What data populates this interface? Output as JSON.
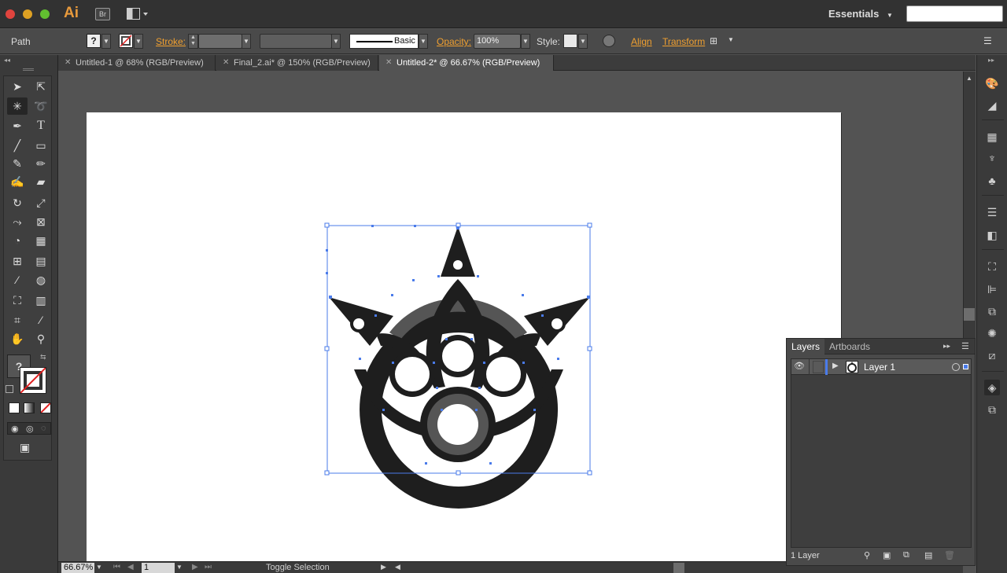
{
  "app": {
    "logo": "Ai",
    "bridge": "Br",
    "workspace": "Essentials",
    "search_placeholder": ""
  },
  "control_bar": {
    "selection_type": "Path",
    "stroke_label": "Stroke:",
    "brush_label": "Basic",
    "opacity_label": "Opacity:",
    "opacity_value": "100%",
    "style_label": "Style:",
    "align_label": "Align",
    "transform_label": "Transform",
    "fill_label": "?"
  },
  "tabs": [
    {
      "label": "Untitled-1 @ 68% (RGB/Preview)",
      "active": false
    },
    {
      "label": "Final_2.ai* @ 150% (RGB/Preview)",
      "active": false
    },
    {
      "label": "Untitled-2* @ 66.67% (RGB/Preview)",
      "active": true
    }
  ],
  "toolbox": {
    "fill_label": "?"
  },
  "status_bar": {
    "zoom": "66.67%",
    "page": "1",
    "status_text": "Toggle Selection"
  },
  "layers_panel": {
    "tabs": [
      "Layers",
      "Artboards"
    ],
    "layers": [
      {
        "name": "Layer 1"
      }
    ],
    "count_label": "1 Layer"
  },
  "colors": {
    "accent_orange": "#f0a030",
    "selection_blue": "#4a7bea",
    "artwork_dark": "#1e1e1e",
    "artwork_grey": "#555555",
    "canvas": "#535353"
  }
}
